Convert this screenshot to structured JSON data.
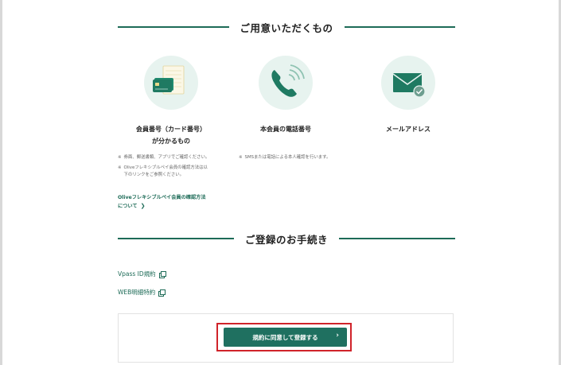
{
  "colors": {
    "brand_green": "#1d6b57",
    "button_green": "#1f7060",
    "circle_bg": "#e7f3ef",
    "highlight_red": "#d0232a"
  },
  "prepare_section": {
    "title": "ご用意いただくもの",
    "items": [
      {
        "icon": "card-icon",
        "title_line1": "会員番号（カード番号）",
        "title_line2": "が分かるもの"
      },
      {
        "icon": "phone-icon",
        "title_line1": "本会員の電話番号",
        "title_line2": ""
      },
      {
        "icon": "mail-icon",
        "title_line1": "メールアドレス",
        "title_line2": ""
      }
    ],
    "card_notes": [
      {
        "mark": "※",
        "text": "券面、郵送書類、アプリでご確認ください。"
      },
      {
        "mark": "※",
        "text": "Oliveフレキシブルペイ会員の確認方法は以下のリンクをご参照ください。"
      }
    ],
    "phone_notes": [
      {
        "mark": "※",
        "text": "SMSまたは電話による本人確認を行います。"
      }
    ],
    "olive_link_line1": "Oliveフレキシブルペイ会員の確認方法",
    "olive_link_line2": "について",
    "olive_link_icon": "chevron-right-icon"
  },
  "procedure_section": {
    "title": "ご登録のお手続き",
    "links": [
      {
        "label": "Vpass ID規約",
        "icon": "external-window-icon"
      },
      {
        "label": "WEB明細特約",
        "icon": "external-window-icon"
      }
    ],
    "submit_label": "規約に同意して登録する",
    "submit_icon": "chevron-right-icon"
  }
}
